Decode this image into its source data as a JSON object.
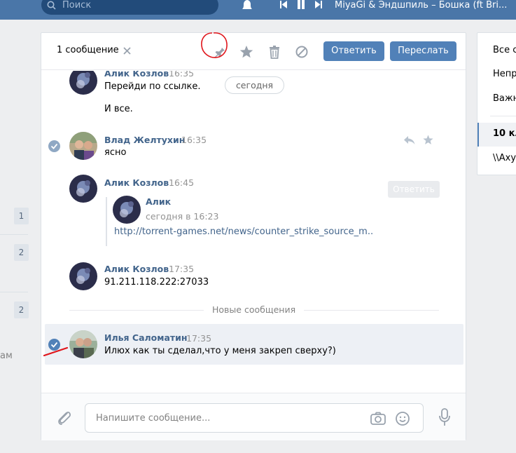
{
  "topbar": {
    "search_placeholder": "Поиск",
    "track_title": "MiyaGi & Эндшпиль – Бошка (ft Bri..."
  },
  "left_sidebar": {
    "badges": [
      "1",
      "2",
      "2"
    ],
    "partial_text": "ам"
  },
  "header": {
    "selected_count": "1 сообщение",
    "reply_label": "Ответить",
    "forward_label": "Переслать"
  },
  "messages": {
    "date_pill": "сегодня",
    "tooltip": "Ответить",
    "m1": {
      "author": "Алик Козлов",
      "time": "16:35",
      "lines": [
        "Перейди по ссылке.",
        "И все."
      ]
    },
    "m2": {
      "author": "Влад Желтухин",
      "time": "16:35",
      "text": "ясно"
    },
    "m3": {
      "author": "Алик Козлов",
      "time": "16:45",
      "forwarded": {
        "author": "Алик",
        "time": "сегодня в 16:23",
        "link": "http://torrent-games.net/news/counter_strike_source_m.."
      }
    },
    "m4": {
      "author": "Алик Козлов",
      "time": "17:35",
      "text": "91.211.118.222:27033"
    },
    "new_divider": "Новые сообщения",
    "m5": {
      "author": "Илья Саломатин",
      "time": "17:35",
      "text": "Илюх как ты сделал,что у меня закреп сверху?)"
    }
  },
  "composer": {
    "placeholder": "Напишите сообщение..."
  },
  "right_menu": {
    "items": [
      "Все с",
      "Непр",
      "Важн",
      "10 кл",
      "\\\\Axy"
    ]
  },
  "colors": {
    "accent": "#5181b8",
    "topbar": "#4a76a8",
    "author": "#42648b",
    "annotation": "#e0151b"
  }
}
